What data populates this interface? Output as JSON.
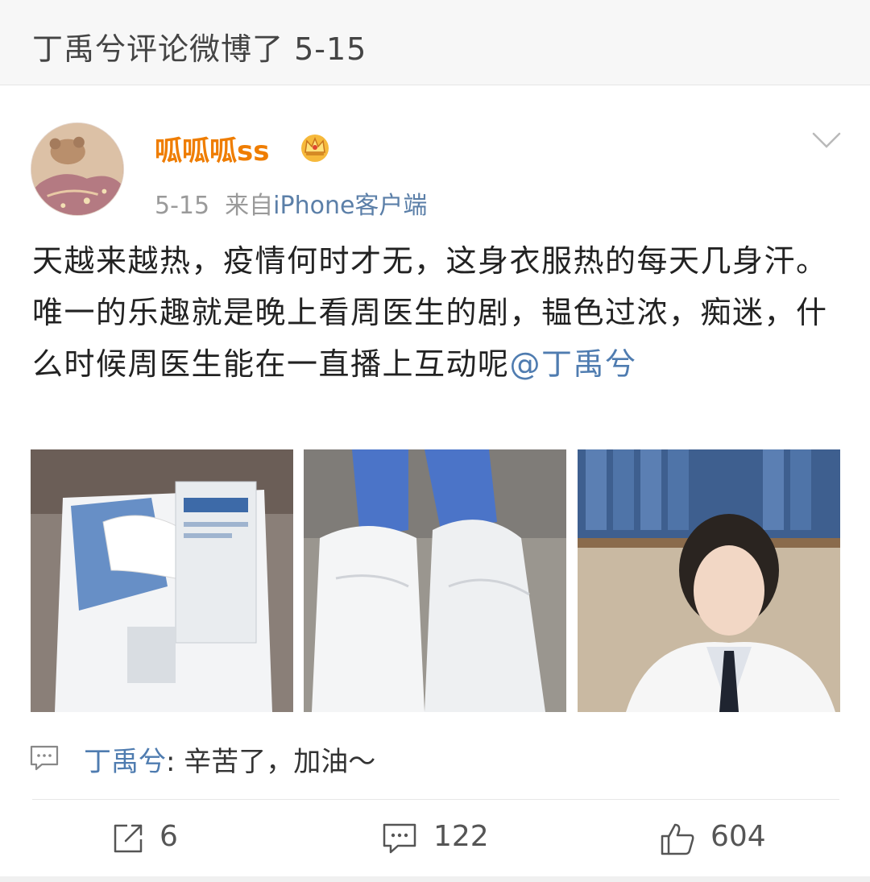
{
  "header": {
    "title": "丁禹兮评论微博了 5-15"
  },
  "post": {
    "author": {
      "name": "呱呱呱ss",
      "avatar": "avatar",
      "badge_icon": "crown-icon",
      "name_color": "#ef7d00"
    },
    "time": "5-15",
    "source_prefix": "来自",
    "source_client": "iPhone客户端",
    "text": "天越来越热，疫情何时才无，这身衣服热的每天几身汗。唯一的乐趣就是晚上看周医生的剧，韫色过浓，痴迷，什么时候周医生能在一直播上互动呢",
    "mention": "@丁禹兮",
    "images": [
      "photo-ppe-package",
      "photo-protective-suit-legs",
      "photo-doctor-white-coat"
    ],
    "reply": {
      "icon": "comment-bubble-icon",
      "author": "丁禹兮",
      "separator": ": ",
      "text": "辛苦了，加油～"
    },
    "actions": {
      "repost": {
        "icon": "repost-icon",
        "count": "6"
      },
      "comment": {
        "icon": "comment-icon",
        "count": "122"
      },
      "like": {
        "icon": "thumbs-up-icon",
        "count": "604"
      }
    },
    "menu_icon": "chevron-down-icon"
  },
  "colors": {
    "link": "#4f7cb0",
    "username": "#ef7d00",
    "meta": "#9a9a9a",
    "text": "#222222"
  }
}
